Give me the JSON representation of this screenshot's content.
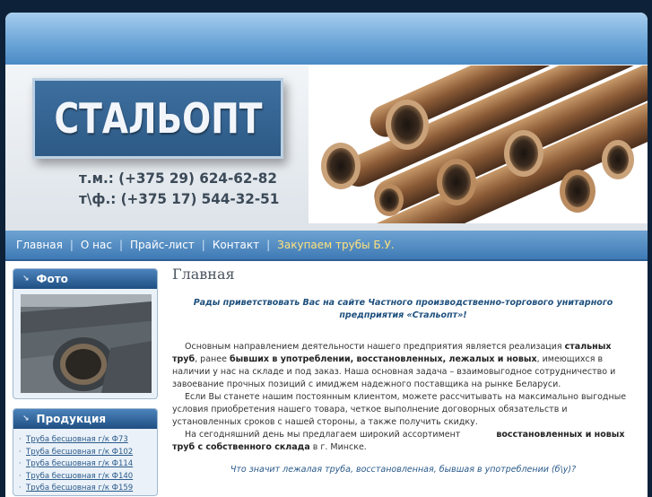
{
  "header": {
    "logo": "СТАЛЬОПТ",
    "phone_mobile": "т.м.: (+375 29)  624-62-82",
    "phone_fax": "т\\ф.: (+375 17)  544-32-51"
  },
  "nav": {
    "items": [
      "Главная",
      "О нас",
      "Прайс-лист",
      "Контакт",
      "Закупаем трубы Б.У."
    ]
  },
  "sidebar": {
    "photo_title": "Фото",
    "products_title": "Продукция",
    "products": [
      "Труба бесшовная г/к Ф73",
      "Труба бесшовная г/к Ф102",
      "Труба бесшовная г/к Ф114",
      "Труба бесшовная г/к Ф140",
      "Труба бесшовная г/к Ф159"
    ]
  },
  "main": {
    "title": "Главная",
    "welcome": "Рады приветствовать Вас на сайте Частного производственно-торгового унитарного предприятия «Стальопт»!",
    "p1_a": "Основным направлением деятельности нашего предприятия является реализация ",
    "p1_b": "стальных труб",
    "p1_c": ", ранее ",
    "p1_d": "бывших в употреблении, восстановленных, лежалых и новых",
    "p1_e": ", имеющихся в наличии у нас на складе и под заказ. Наша основная задача – взаимовыгодное сотрудничество и завоевание прочных позиций с имиджем надежного поставщика на рынке Беларуси.",
    "p2": "Если Вы станете нашим постоянным клиентом, можете рассчитывать на максимально выгодные условия приобретения нашего товара, четкое выполнение договорных обязательств и установленных сроков с нашей стороны, а также получить скидку.",
    "p3_a": "На сегодняшний день мы предлагаем широкий ассортимент",
    "p3_b": "восстановленных и новых труб с собственного склада",
    "p3_c": " в г. Минске.",
    "question": "Что значит лежалая труба, восстановленная, бывшая в употреблении (б\\у)?"
  }
}
